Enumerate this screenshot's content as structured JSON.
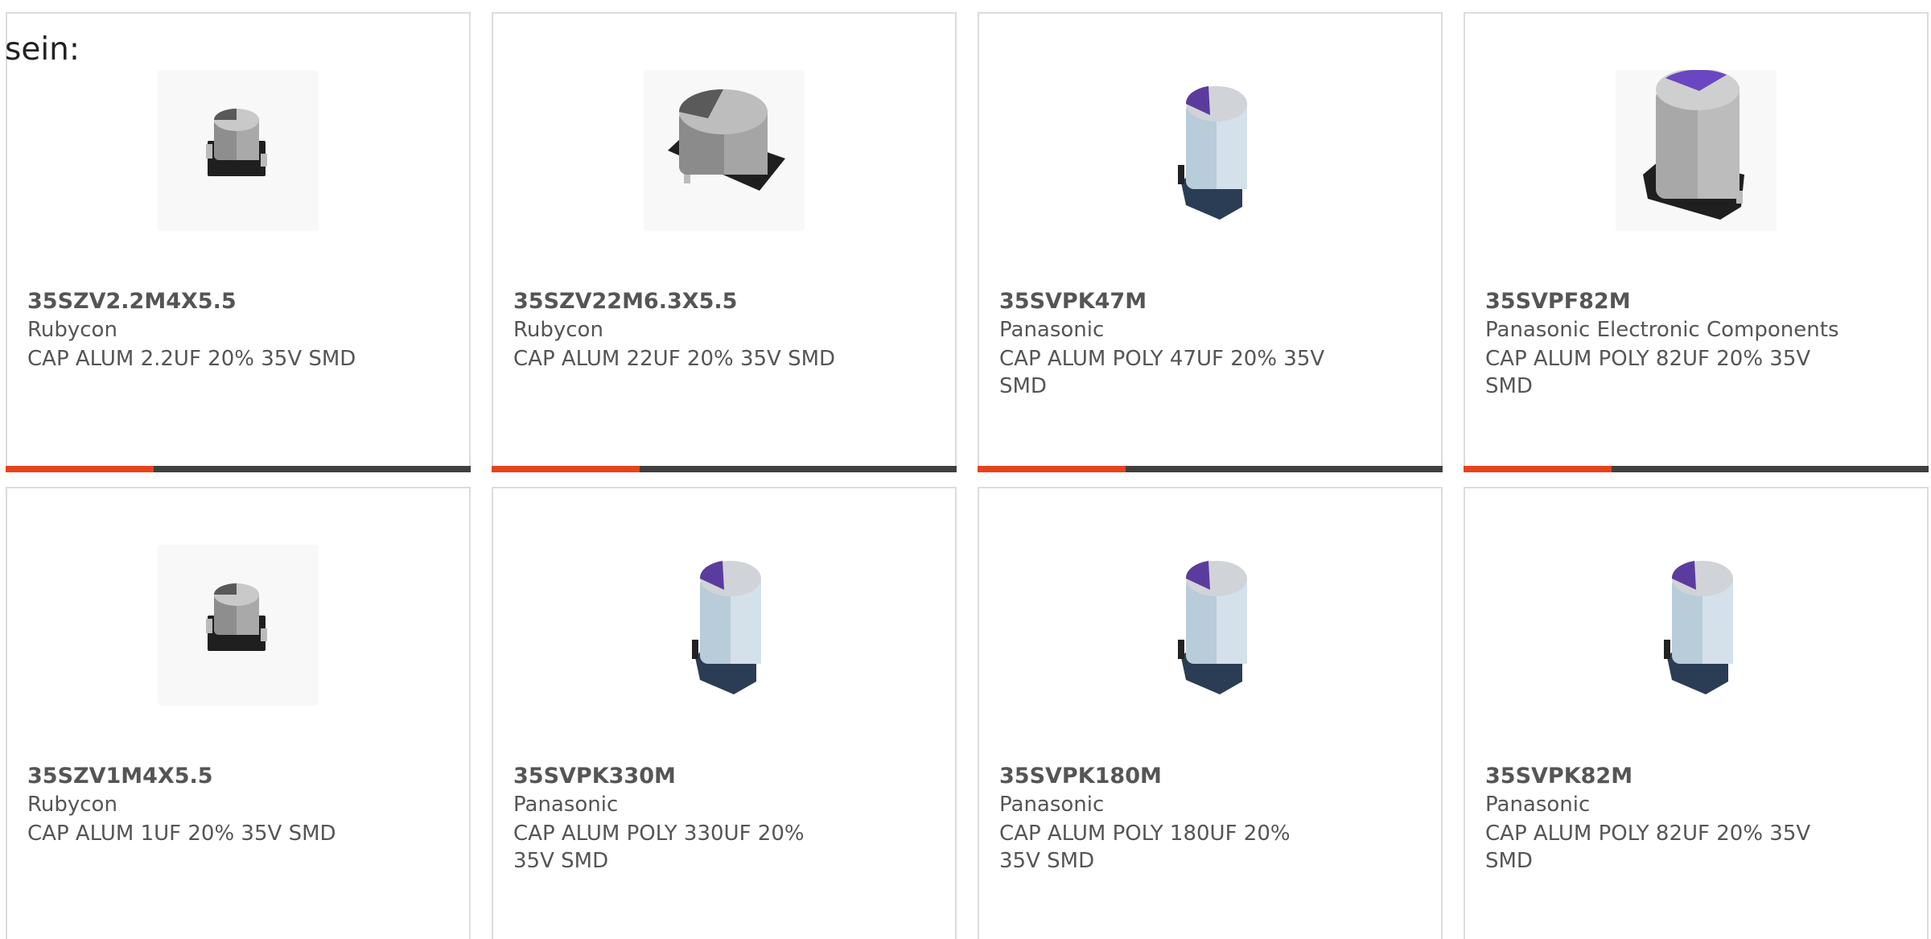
{
  "lead_text": "sein:",
  "colors": {
    "accent": "#e8421b",
    "bar": "#404040",
    "card_border": "#dcdcdc",
    "text": "#555555"
  },
  "products": [
    {
      "part_number": "35SZV2.2M4X5.5",
      "manufacturer": "Rubycon",
      "description": "CAP ALUM 2.2UF 20% 35V SMD",
      "image": "small-aluminum-capacitor"
    },
    {
      "part_number": "35SZV22M6.3X5.5",
      "manufacturer": "Rubycon",
      "description": "CAP ALUM 22UF 20% 35V SMD",
      "image": "wide-aluminum-capacitor"
    },
    {
      "part_number": "35SVPK47M",
      "manufacturer": "Panasonic",
      "description": "CAP ALUM POLY 47UF 20% 35V SMD",
      "image": "polymer-capacitor-purple-top"
    },
    {
      "part_number": "35SVPF82M",
      "manufacturer": "Panasonic Electronic Components",
      "description": "CAP ALUM POLY 82UF 20% 35V SMD",
      "image": "tall-polymer-capacitor"
    },
    {
      "part_number": "35SZV1M4X5.5",
      "manufacturer": "Rubycon",
      "description": "CAP ALUM 1UF 20% 35V SMD",
      "image": "small-aluminum-capacitor"
    },
    {
      "part_number": "35SVPK330M",
      "manufacturer": "Panasonic",
      "description": "CAP ALUM POLY 330UF 20% 35V SMD",
      "image": "polymer-capacitor-purple-top"
    },
    {
      "part_number": "35SVPK180M",
      "manufacturer": "Panasonic",
      "description": "CAP ALUM POLY 180UF 20% 35V SMD",
      "image": "polymer-capacitor-purple-top"
    },
    {
      "part_number": "35SVPK82M",
      "manufacturer": "Panasonic",
      "description": "CAP ALUM POLY 82UF 20% 35V SMD",
      "image": "polymer-capacitor-purple-top"
    }
  ]
}
